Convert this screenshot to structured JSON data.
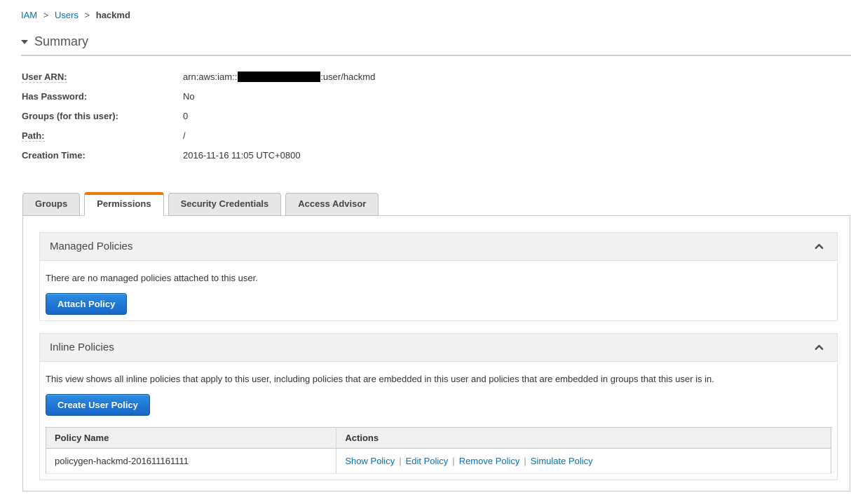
{
  "breadcrumb": {
    "separator": ">",
    "links": [
      {
        "label": "IAM"
      },
      {
        "label": "Users"
      }
    ],
    "current": "hackmd"
  },
  "summary": {
    "title": "Summary",
    "fields": [
      {
        "label": "User ARN:",
        "tooltip": true,
        "value_prefix": "arn:aws:iam::",
        "redacted": "account-id",
        "value_suffix": ":user/hackmd"
      },
      {
        "label": "Has Password:",
        "value": "No"
      },
      {
        "label": "Groups (for this user):",
        "value": "0"
      },
      {
        "label": "Path:",
        "tooltip": true,
        "value": "/"
      },
      {
        "label": "Creation Time:",
        "value": "2016-11-16 11:05 UTC+0800"
      }
    ]
  },
  "tabs": [
    {
      "label": "Groups",
      "active": false
    },
    {
      "label": "Permissions",
      "active": true
    },
    {
      "label": "Security Credentials",
      "active": false
    },
    {
      "label": "Access Advisor",
      "active": false
    }
  ],
  "managed_policies": {
    "title": "Managed Policies",
    "empty_message": "There are no managed policies attached to this user.",
    "attach_button": "Attach Policy"
  },
  "inline_policies": {
    "title": "Inline Policies",
    "description": "This view shows all inline policies that apply to this user, including policies that are embedded in this user and policies that are embedded in groups that this user is in.",
    "create_button": "Create User Policy",
    "table": {
      "columns": [
        "Policy Name",
        "Actions"
      ],
      "actions_separator": "|",
      "rows": [
        {
          "policy_name": "policygen-hackmd-201611161111",
          "actions": [
            "Show Policy",
            "Edit Policy",
            "Remove Policy",
            "Simulate Policy"
          ]
        }
      ]
    }
  },
  "colors": {
    "link_blue": "#0073bb",
    "button_blue_top": "#2d8ce2",
    "button_blue_bottom": "#1566c6",
    "tab_active_orange": "#ee7601",
    "section_header_gray": "#f1f1f1",
    "redaction_black": "#000000"
  }
}
